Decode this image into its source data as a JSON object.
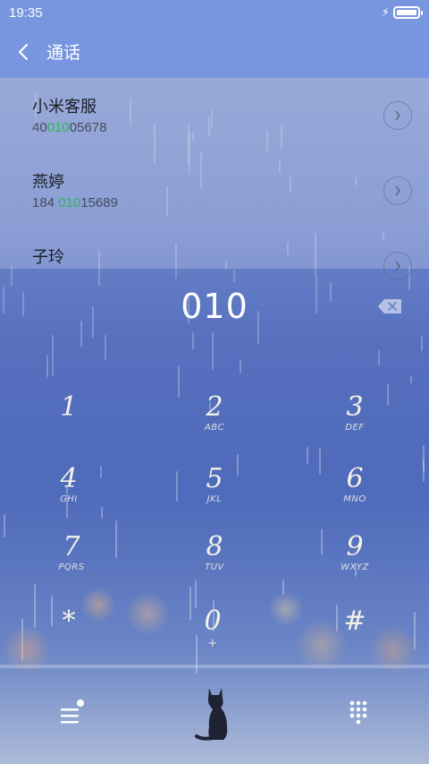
{
  "status_bar": {
    "time": "19:35",
    "charging_icon": "bolt-icon",
    "battery_level": 1.0
  },
  "header": {
    "back_icon": "chevron-left-icon",
    "title": "通话"
  },
  "contacts": [
    {
      "name": "小米客服",
      "number_pre": "40",
      "number_match": "010",
      "number_post": "05678"
    },
    {
      "name": "燕婷",
      "number_pre": "184 ",
      "number_match": "010",
      "number_post": "15689"
    },
    {
      "name": "子玲",
      "number_pre": "",
      "number_match": "",
      "number_post": ""
    }
  ],
  "dialpad": {
    "display": "010",
    "keys": [
      {
        "digit": "1",
        "letters": ""
      },
      {
        "digit": "2",
        "letters": "ABC"
      },
      {
        "digit": "3",
        "letters": "DEF"
      },
      {
        "digit": "4",
        "letters": "GHI"
      },
      {
        "digit": "5",
        "letters": "JKL"
      },
      {
        "digit": "6",
        "letters": "MNO"
      },
      {
        "digit": "7",
        "letters": "PQRS"
      },
      {
        "digit": "8",
        "letters": "TUV"
      },
      {
        "digit": "9",
        "letters": "WXYZ"
      },
      {
        "digit": "*",
        "letters": ""
      },
      {
        "digit": "0",
        "letters": "+"
      },
      {
        "digit": "#",
        "letters": ""
      }
    ]
  },
  "bottom_bar": {
    "menu_icon": "menu-icon",
    "dialpad_icon": "dialpad-grid-icon"
  },
  "colors": {
    "header_bg": "#7896df",
    "match_highlight": "#2fb45a",
    "text_light": "#f4f2e8"
  }
}
